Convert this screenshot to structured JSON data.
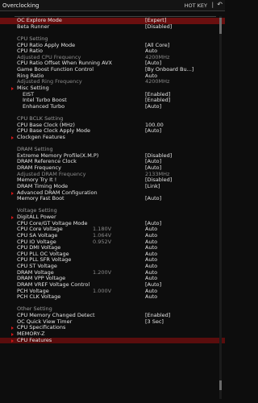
{
  "header": {
    "title": "Overclocking",
    "hotkey": "HOT KEY",
    "back_symbol": "|",
    "close_symbol": "↶"
  },
  "rows": [
    {
      "type": "item",
      "label": "OC Explore Mode",
      "value": "[Expert]",
      "mid": "",
      "state": "sel"
    },
    {
      "type": "item",
      "label": "Beta Runner",
      "value": "[Disabled]",
      "mid": ""
    },
    {
      "type": "blank"
    },
    {
      "type": "section",
      "label": "CPU Setting"
    },
    {
      "type": "item",
      "label": "CPU Ratio Apply Mode",
      "value": "[All Core]",
      "mid": ""
    },
    {
      "type": "item",
      "label": "CPU Ratio",
      "value": "Auto",
      "mid": ""
    },
    {
      "type": "item",
      "label": "Adjusted CPU Frequency",
      "value": "4200MHz",
      "mid": "",
      "state": "dim"
    },
    {
      "type": "item",
      "label": "CPU Ratio Offset When Running AVX",
      "value": "[Auto]",
      "mid": ""
    },
    {
      "type": "item",
      "label": "Game Boost Function Control",
      "value": "[By Onboard Bu...]",
      "mid": ""
    },
    {
      "type": "item",
      "label": "Ring Ratio",
      "value": "Auto",
      "mid": ""
    },
    {
      "type": "item",
      "label": "Adjusted Ring Frequency",
      "value": "4200MHz",
      "mid": "",
      "state": "dim"
    },
    {
      "type": "sub",
      "label": "Misc Setting"
    },
    {
      "type": "item",
      "label": "EIST",
      "value": "[Enabled]",
      "mid": "",
      "indent": true
    },
    {
      "type": "item",
      "label": "Intel Turbo Boost",
      "value": "[Enabled]",
      "mid": "",
      "indent": true
    },
    {
      "type": "item",
      "label": "Enhanced Turbo",
      "value": "[Auto]",
      "mid": "",
      "indent": true
    },
    {
      "type": "blank"
    },
    {
      "type": "section",
      "label": "CPU BCLK Setting"
    },
    {
      "type": "item",
      "label": "CPU Base Clock (MHz)",
      "value": "100.00",
      "mid": ""
    },
    {
      "type": "item",
      "label": "CPU Base Clock Apply Mode",
      "value": "[Auto]",
      "mid": ""
    },
    {
      "type": "sub",
      "label": "Clockgen Features"
    },
    {
      "type": "blank"
    },
    {
      "type": "section",
      "label": "DRAM Setting"
    },
    {
      "type": "item",
      "label": "Extreme Memory Profile(X.M.P)",
      "value": "[Disabled]",
      "mid": ""
    },
    {
      "type": "item",
      "label": "DRAM Reference Clock",
      "value": "[Auto]",
      "mid": ""
    },
    {
      "type": "item",
      "label": "DRAM Frequency",
      "value": "[Auto]",
      "mid": ""
    },
    {
      "type": "item",
      "label": "Adjusted DRAM Frequency",
      "value": "2133MHz",
      "mid": "",
      "state": "dim"
    },
    {
      "type": "item",
      "label": "Memory Try It !",
      "value": "[Disabled]",
      "mid": ""
    },
    {
      "type": "item",
      "label": "DRAM Timing Mode",
      "value": "[Link]",
      "mid": ""
    },
    {
      "type": "sub",
      "label": "Advanced DRAM Configuration"
    },
    {
      "type": "item",
      "label": "Memory Fast Boot",
      "value": "[Auto]",
      "mid": ""
    },
    {
      "type": "blank"
    },
    {
      "type": "section",
      "label": "Voltage Setting"
    },
    {
      "type": "sub",
      "label": "DigitALL Power"
    },
    {
      "type": "item",
      "label": "CPU Core/GT Voltage Mode",
      "value": "[Auto]",
      "mid": ""
    },
    {
      "type": "item",
      "label": "CPU Core Voltage",
      "value": "Auto",
      "mid": "1.180V"
    },
    {
      "type": "item",
      "label": "CPU SA Voltage",
      "value": "Auto",
      "mid": "1.064V"
    },
    {
      "type": "item",
      "label": "CPU IO Voltage",
      "value": "Auto",
      "mid": "0.952V"
    },
    {
      "type": "item",
      "label": "CPU DMI Voltage",
      "value": "Auto",
      "mid": ""
    },
    {
      "type": "item",
      "label": "CPU PLL OC Voltage",
      "value": "Auto",
      "mid": ""
    },
    {
      "type": "item",
      "label": "CPU PLL SFR Voltage",
      "value": "Auto",
      "mid": ""
    },
    {
      "type": "item",
      "label": "CPU ST Voltage",
      "value": "Auto",
      "mid": ""
    },
    {
      "type": "item",
      "label": "DRAM Voltage",
      "value": "Auto",
      "mid": "1.200V"
    },
    {
      "type": "item",
      "label": "DRAM VPP Voltage",
      "value": "Auto",
      "mid": ""
    },
    {
      "type": "item",
      "label": "DRAM VREF Voltage Control",
      "value": "[Auto]",
      "mid": ""
    },
    {
      "type": "item",
      "label": "PCH Voltage",
      "value": "Auto",
      "mid": "1.000V"
    },
    {
      "type": "item",
      "label": "PCH CLK Voltage",
      "value": "Auto",
      "mid": ""
    },
    {
      "type": "blank"
    },
    {
      "type": "section",
      "label": "Other Setting"
    },
    {
      "type": "item",
      "label": "CPU Memory Changed Detect",
      "value": "[Enabled]",
      "mid": ""
    },
    {
      "type": "item",
      "label": "OC Quick View Timer",
      "value": "[3 Sec]",
      "mid": ""
    },
    {
      "type": "sub",
      "label": "CPU Specifications"
    },
    {
      "type": "sub",
      "label": "MEMORY-Z"
    },
    {
      "type": "sub",
      "label": "CPU Features",
      "state": "last"
    }
  ]
}
